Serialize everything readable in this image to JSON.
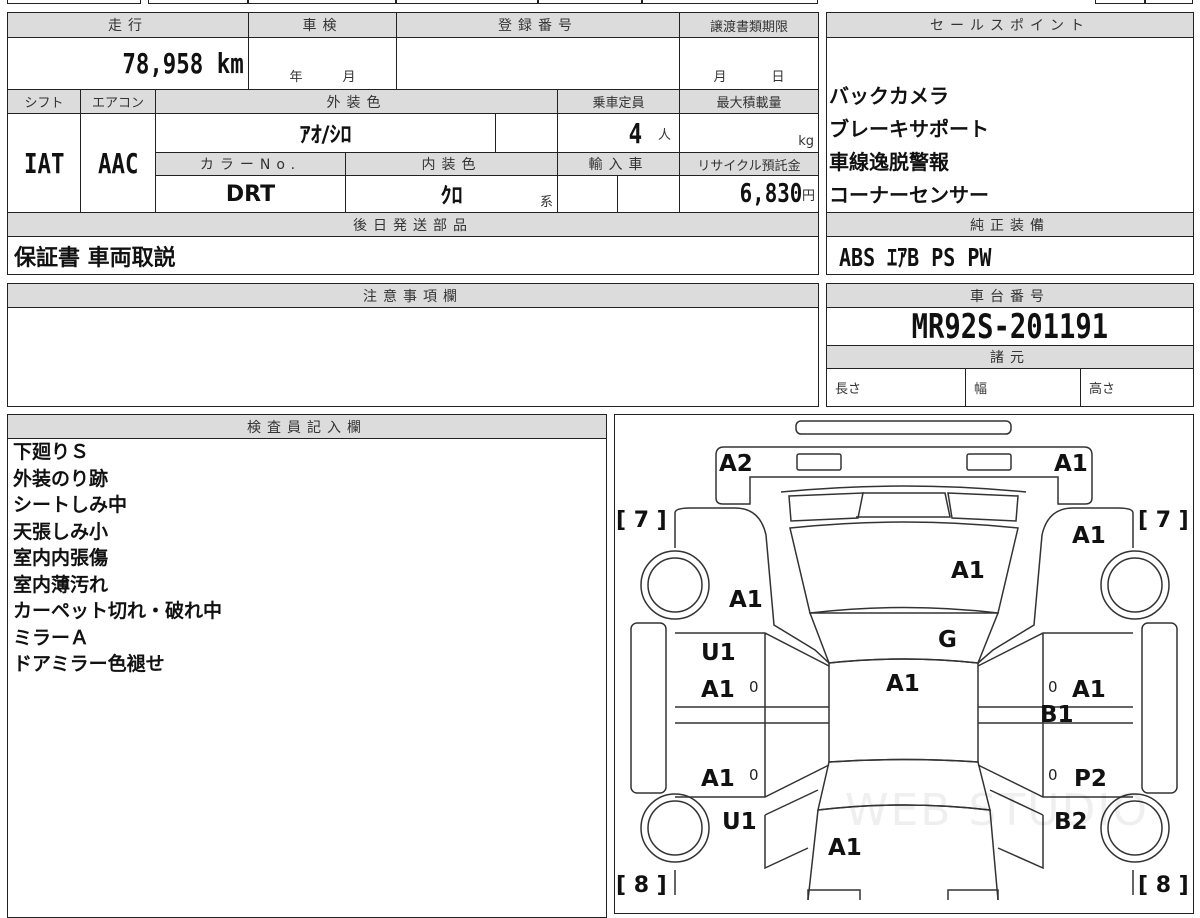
{
  "mileage": {
    "label": "走行",
    "value": "78,958",
    "unit": "km"
  },
  "shaken": {
    "label": "車検",
    "year_unit": "年",
    "month_unit": "月"
  },
  "registration": {
    "label": "登録番号",
    "value": ""
  },
  "transfer_deadline": {
    "label": "譲渡書類期限",
    "month_unit": "月",
    "day_unit": "日"
  },
  "shift": {
    "label": "シフト",
    "value": "IAT"
  },
  "aircon": {
    "label": "エアコン",
    "value": "AAC"
  },
  "exterior_color": {
    "label": "外装色",
    "value": "ｱｵ/ｼﾛ"
  },
  "capacity": {
    "label": "乗車定員",
    "value": "4",
    "unit": "人"
  },
  "max_load": {
    "label": "最大積載量",
    "unit": "kg"
  },
  "color_no": {
    "label": "カラーNo.",
    "value": "DRT"
  },
  "interior_color": {
    "label": "内装色",
    "value": "ｸﾛ",
    "suffix": "系"
  },
  "import_car": {
    "label": "輸入車"
  },
  "recycle_fee": {
    "label": "リサイクル預託金",
    "value": "6,830",
    "unit": "円"
  },
  "later_parts": {
    "label": "後日発送部品",
    "value": "保証書 車両取説"
  },
  "sales_points": {
    "label": "セールスポイント",
    "items": [
      "バックカメラ",
      "ブレーキサポート",
      "車線逸脱警報",
      "コーナーセンサー"
    ]
  },
  "genuine_equipment": {
    "label": "純正装備",
    "value": "ABS ｴｱB PS PW"
  },
  "caution": {
    "label": "注意事項欄",
    "value": ""
  },
  "chassis": {
    "label": "車台番号",
    "value": "MR92S-201191"
  },
  "specs": {
    "label": "諸元",
    "length": "長さ",
    "width": "幅",
    "height": "高さ"
  },
  "inspector": {
    "label": "検査員記入欄",
    "notes": [
      "下廻りＳ",
      "外装のり跡",
      "シートしみ中",
      "天張しみ小",
      "室内内張傷",
      "室内薄汚れ",
      "カーペット切れ・破れ中",
      "ミラーＡ",
      "ドアミラー色褪せ"
    ]
  },
  "diagram": {
    "marks": [
      "A2",
      "A1",
      "A1",
      "A1",
      "A1",
      "G",
      "U1",
      "A1",
      "A1",
      "A1",
      "B1",
      "A1",
      "P2",
      "U1",
      "B2",
      "A1"
    ],
    "tire_front_left": "[ 7 ]",
    "tire_front_right": "[ 7 ]",
    "tire_rear_left": "[ 8 ]",
    "tire_rear_right": "[ 8 ]",
    "zero_mark": "0",
    "watermark": "WEB STUDIO"
  }
}
